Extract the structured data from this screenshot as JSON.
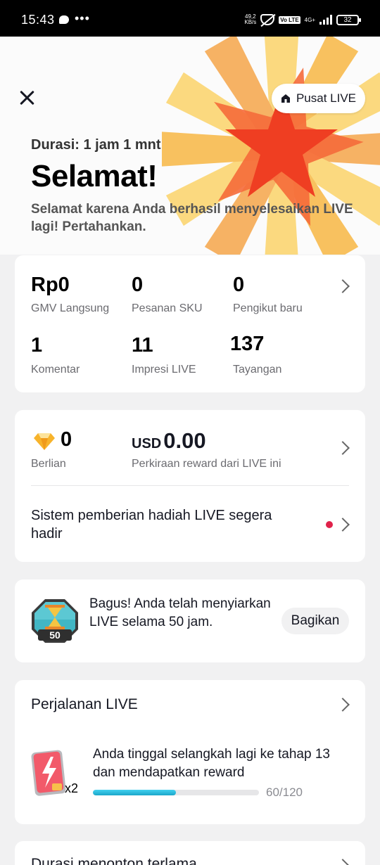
{
  "status_bar": {
    "time": "15:43",
    "speed_top": "49,2",
    "speed_bottom": "KB/s",
    "volte": "Vo LTE",
    "network": "4G+",
    "battery": "32"
  },
  "header": {
    "pusat_label": "Pusat LIVE",
    "durasi": "Durasi: 1 jam 1 mnt",
    "title": "Selamat!",
    "description": "Selamat karena Anda berhasil menyelesaikan LIVE lagi! Pertahankan."
  },
  "stats": [
    {
      "value": "Rp0",
      "label": "GMV Langsung"
    },
    {
      "value": "0",
      "label": "Pesanan SKU"
    },
    {
      "value": "0",
      "label": "Pengikut baru"
    },
    {
      "value": "1",
      "label": "Komentar"
    },
    {
      "value": "11",
      "label": "Impresi LIVE"
    },
    {
      "value": "137",
      "label": "Tayangan"
    }
  ],
  "rewards": {
    "diamonds_value": "0",
    "diamonds_label": "Berlian",
    "usd_prefix": "USD",
    "usd_value": "0.00",
    "usd_label": "Perkiraan reward dari LIVE ini",
    "sistem_text": "Sistem pemberian hadiah LIVE segera hadir"
  },
  "achievement": {
    "badge_number": "50",
    "text": "Bagus! Anda telah menyiarkan LIVE selama 50 jam.",
    "share_label": "Bagikan"
  },
  "journey": {
    "title": "Perjalanan LIVE",
    "multiplier": "x2",
    "text": "Anda tinggal selangkah lagi ke tahap 13 dan mendapatkan reward",
    "progress_text": "60/120",
    "progress_fraction": 0.5
  },
  "next_section": {
    "title": "Durasi menonton terlama"
  },
  "colors": {
    "progress": "#1fb3d6",
    "notification_dot": "#e0224a"
  }
}
